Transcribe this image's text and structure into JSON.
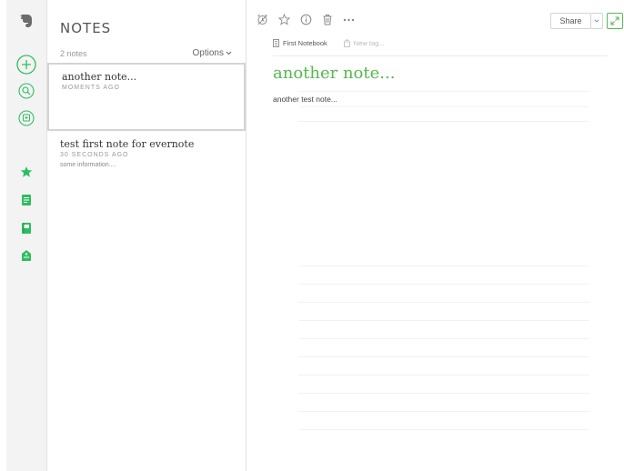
{
  "colors": {
    "brand_green": "#2dbe60",
    "accent_green": "#55b94f",
    "rail_bg": "#f3f3f3",
    "selected_border": "#d4d4d4"
  },
  "sidebar": {
    "icons": [
      "elephant-logo-icon",
      "new-note-icon",
      "search-icon",
      "work-chat-icon",
      "shortcuts-star-icon",
      "notes-icon",
      "notebooks-icon",
      "tags-icon"
    ]
  },
  "notes_list": {
    "title": "NOTES",
    "count": "2 notes",
    "options_label": "Options",
    "items": [
      {
        "title": "another note...",
        "meta": "MOMENTS AGO",
        "snippet": ""
      },
      {
        "title": "test first note for evernote",
        "meta": "30 SECONDS AGO",
        "snippet": "some information...."
      }
    ]
  },
  "editor": {
    "toolbar_icons": [
      "reminder-alarm-icon",
      "favorite-star-icon",
      "info-icon",
      "trash-icon",
      "more-icon"
    ],
    "share_label": "Share",
    "notebook": "First Notebook",
    "tag_placeholder": "New tag...",
    "note_title": "another note...",
    "note_body": "another test note..."
  }
}
